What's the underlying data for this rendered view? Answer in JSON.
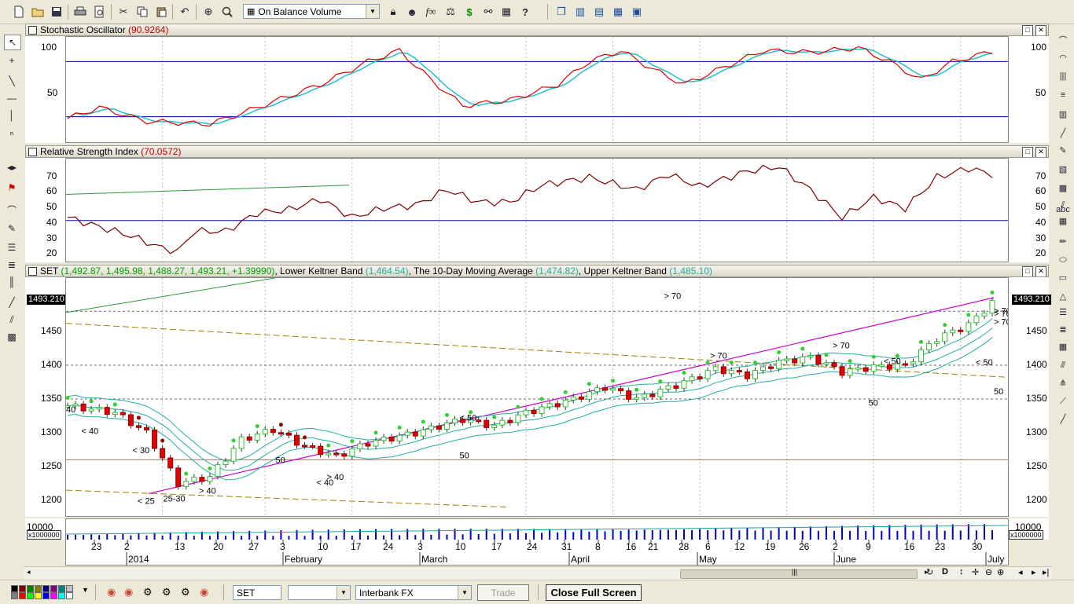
{
  "toolbar": {
    "indicator_select": "On Balance Volume",
    "icons": [
      "new-file-icon",
      "open-folder-icon",
      "save-icon",
      "print-icon",
      "print-preview-icon",
      "cut-icon",
      "copy-icon",
      "paste-icon",
      "undo-icon",
      "crosshair-icon",
      "zoom-icon",
      "lock-icon",
      "user-icon",
      "formula-icon",
      "expert-icon",
      "dollar-icon",
      "binoculars-icon",
      "grid-icon",
      "help-icon",
      "cascade-icon",
      "tile-vertical-icon",
      "tile-horizontal-icon",
      "tile-grid-icon",
      "screenshot-icon"
    ]
  },
  "panes": {
    "stochastic": {
      "title": "Stochastic Oscillator",
      "value": "(90.9264)",
      "y_labels": [
        "100",
        "50"
      ],
      "levels": [
        80,
        20
      ]
    },
    "rsi": {
      "title": "Relative Strength Index",
      "value": "(70.0572)",
      "y_labels": [
        "70",
        "60",
        "50",
        "40",
        "30",
        "20"
      ],
      "level": 40
    },
    "price": {
      "symbol": "SET",
      "ohlc": "(1,492.87, 1,495.98, 1,488.27, 1,493.21, +1.39990)",
      "lower_keltner_label": "Lower Keltner Band",
      "lower_keltner_value": "(1,464.54)",
      "ma_label": "The 10-Day Moving Average",
      "ma_value": "(1,474.82)",
      "upper_keltner_label": "Upper Keltner Band",
      "upper_keltner_value": "(1,485.10)",
      "last_price": "1493.210",
      "y_labels": [
        "1450",
        "1400",
        "1350",
        "1300",
        "1250",
        "1200"
      ],
      "annotations": [
        "40",
        "< 40",
        "< 30",
        "< 25",
        "25-30",
        "> 40",
        "50",
        "> 40",
        "< 40",
        "< 50",
        "50",
        "> 70",
        "> 70",
        "> 70",
        "< 50",
        "50",
        "< 50",
        "50",
        "> 70",
        "> 70",
        "> 70"
      ]
    },
    "volume": {
      "y_label": "10000",
      "multiplier": "x1000000"
    }
  },
  "dates": {
    "days": [
      "23",
      "2",
      "13",
      "20",
      "27",
      "3",
      "10",
      "17",
      "24",
      "3",
      "10",
      "17",
      "24",
      "31",
      "8",
      "16",
      "21",
      "28",
      "6",
      "12",
      "19",
      "26",
      "2",
      "9",
      "16",
      "23",
      "30"
    ],
    "months": [
      "2014",
      "February",
      "March",
      "April",
      "May",
      "June",
      "July"
    ]
  },
  "status": {
    "symbol_input": "SET",
    "second_select": "",
    "exchange_select": "Interbank FX",
    "trade_button": "Trade",
    "full_screen_button": "Close Full Screen"
  },
  "colors": {
    "stoch_k": "#e00000",
    "stoch_d": "#20c0d0",
    "rsi": "#800000",
    "level_line": "#0000a0",
    "keltner": "#20b0a0",
    "trend": "#d000d0",
    "up_candle": "#30c030",
    "down_candle": "#e00000",
    "volume": "#0000c0"
  }
}
